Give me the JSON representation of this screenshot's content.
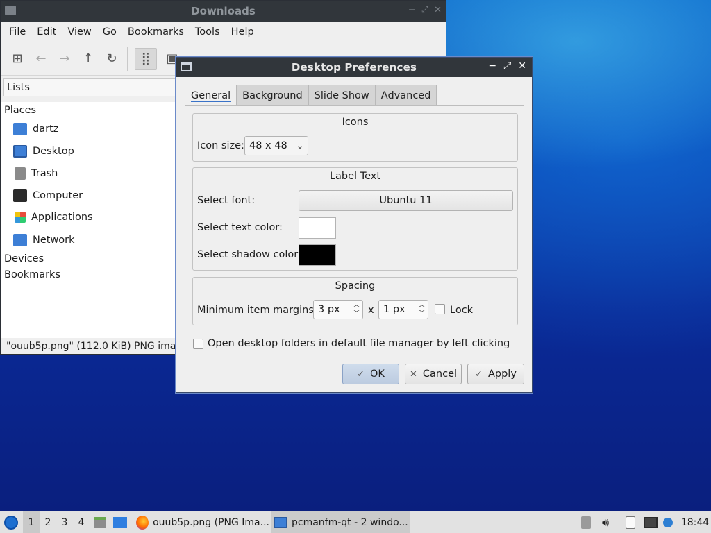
{
  "file_manager": {
    "title": "Downloads",
    "menu": [
      "File",
      "Edit",
      "View",
      "Go",
      "Bookmarks",
      "Tools",
      "Help"
    ],
    "side_panel_mode": "Lists",
    "places_header": "Places",
    "places": [
      "dartz",
      "Desktop",
      "Trash",
      "Computer",
      "Applications",
      "Network"
    ],
    "devices_header": "Devices",
    "bookmarks_header": "Bookmarks",
    "status": "\"ouub5p.png\" (112.0 KiB) PNG image"
  },
  "dialog": {
    "title": "Desktop Preferences",
    "tabs": [
      "General",
      "Background",
      "Slide Show",
      "Advanced"
    ],
    "active_tab": "General",
    "icons_group": {
      "title": "Icons",
      "icon_size_label": "Icon size:",
      "icon_size_value": "48 x 48"
    },
    "label_text_group": {
      "title": "Label Text",
      "font_label": "Select font:",
      "font_value": "Ubuntu 11",
      "text_color_label": "Select text color:",
      "text_color": "#ffffff",
      "shadow_color_label": "Select shadow color:",
      "shadow_color": "#000000"
    },
    "spacing_group": {
      "title": "Spacing",
      "margins_label": "Minimum item margins:",
      "margin_x": "3 px",
      "times": "x",
      "margin_y": "1 px",
      "lock_label": "Lock",
      "lock_checked": false
    },
    "open_folders_label": "Open desktop folders in default file manager by left clicking",
    "open_folders_checked": false,
    "buttons": {
      "ok": "OK",
      "cancel": "Cancel",
      "apply": "Apply"
    }
  },
  "taskbar": {
    "workspaces": [
      "1",
      "2",
      "3",
      "4"
    ],
    "active_workspace": "1",
    "tasks": [
      {
        "label": "ouub5p.png (PNG Ima...",
        "icon": "firefox-icon"
      },
      {
        "label": "pcmanfm-qt - 2 windo...",
        "icon": "folder-icon"
      }
    ],
    "clock": "18:44"
  }
}
